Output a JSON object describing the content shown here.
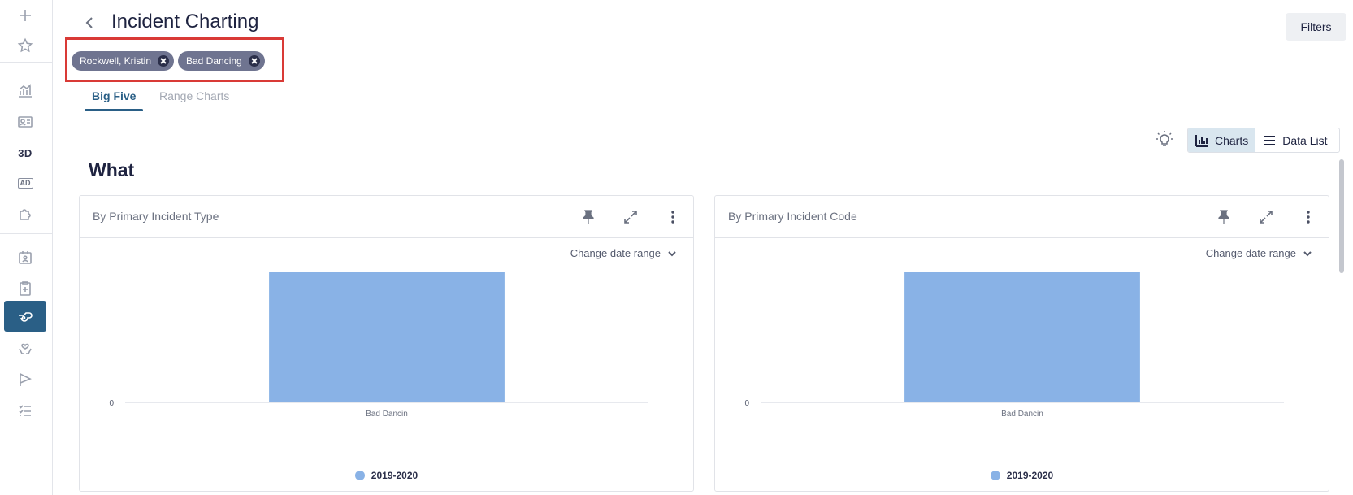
{
  "header": {
    "title": "Incident Charting",
    "filters_label": "Filters"
  },
  "chips": [
    {
      "label": "Rockwell, Kristin"
    },
    {
      "label": "Bad Dancing"
    }
  ],
  "tabs": [
    {
      "label": "Big Five",
      "active": true
    },
    {
      "label": "Range Charts",
      "active": false
    }
  ],
  "view_toggle": {
    "charts_label": "Charts",
    "data_list_label": "Data List",
    "selected": "charts"
  },
  "section_title": "What",
  "colors": {
    "accent": "#2a5f86",
    "bar": "#89b2e6",
    "chip_bg": "#6f7490",
    "highlight_border": "#d93a36"
  },
  "cards": [
    {
      "title": "By Primary Incident Type",
      "date_range_label": "Change date range"
    },
    {
      "title": "By Primary Incident Code",
      "date_range_label": "Change date range"
    }
  ],
  "chart_data": [
    {
      "type": "bar",
      "title": "By Primary Incident Type",
      "categories": [
        "Bad Dancin"
      ],
      "series": [
        {
          "name": "2019-2020",
          "values": [
            1
          ]
        }
      ],
      "y_ticks": [
        "0"
      ],
      "ylim": [
        0,
        1
      ],
      "legend": "bottom",
      "grid": false
    },
    {
      "type": "bar",
      "title": "By Primary Incident Code",
      "categories": [
        "Bad Dancin"
      ],
      "series": [
        {
          "name": "2019-2020",
          "values": [
            1
          ]
        }
      ],
      "y_ticks": [
        "0"
      ],
      "ylim": [
        0,
        1
      ],
      "legend": "bottom",
      "grid": false
    }
  ]
}
